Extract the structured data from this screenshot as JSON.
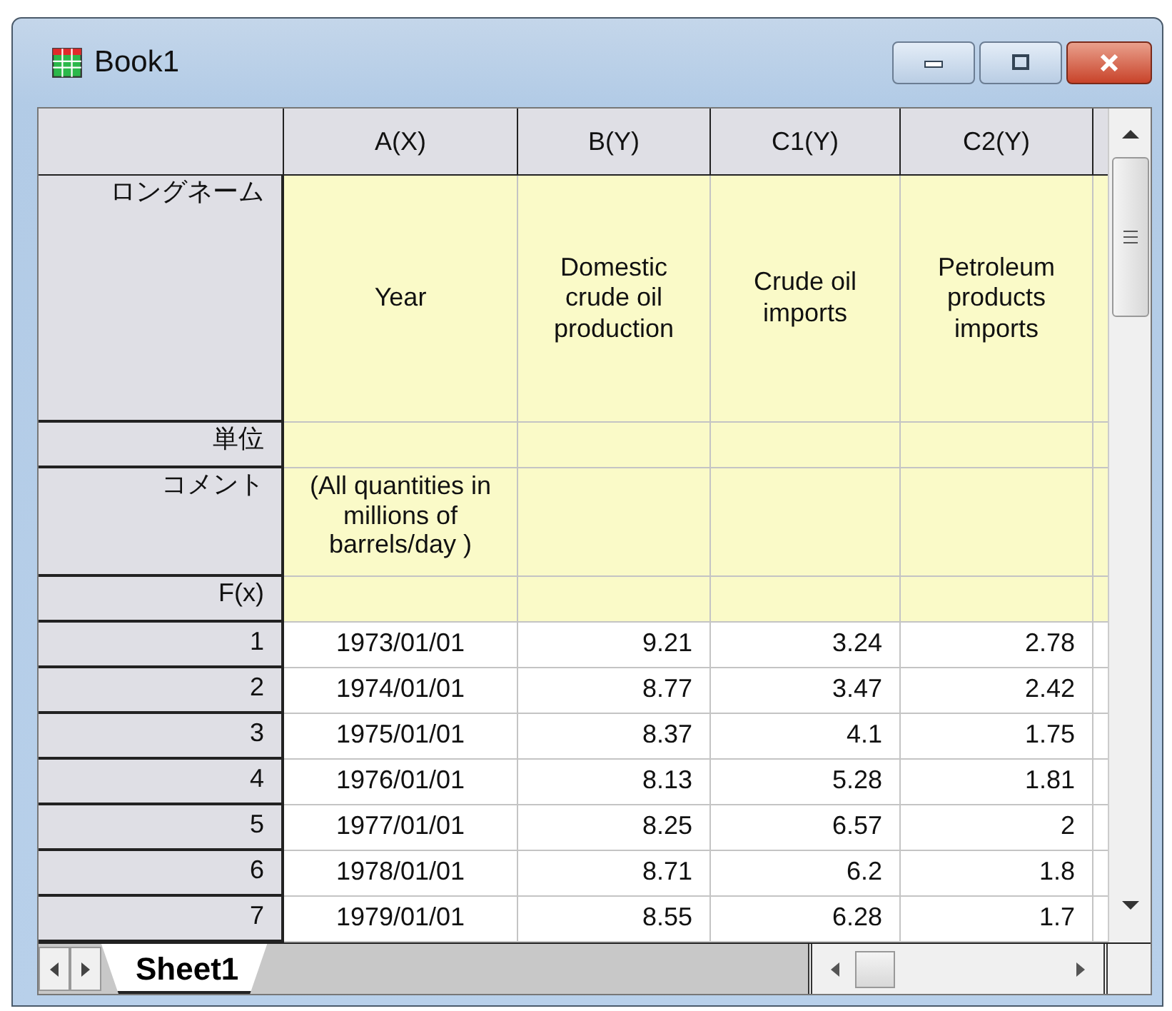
{
  "window": {
    "title": "Book1"
  },
  "columns": [
    {
      "name": "A(X)",
      "long_name": "Year",
      "comment": "(All quantities in millions of barrels/day )"
    },
    {
      "name": "B(Y)",
      "long_name": "Domestic crude oil production"
    },
    {
      "name": "C1(Y)",
      "long_name": "Crude oil imports"
    },
    {
      "name": "C2(Y)",
      "long_name": "Petroleum products imports"
    }
  ],
  "header_rows": [
    {
      "label": "ロングネーム",
      "kind": "long_name"
    },
    {
      "label": "単位",
      "kind": "unit"
    },
    {
      "label": "コメント",
      "kind": "comment"
    },
    {
      "label": "F(x)",
      "kind": "formula"
    }
  ],
  "rows": [
    {
      "label": "1",
      "cells": [
        "1973/01/01",
        "9.21",
        "3.24",
        "2.78"
      ]
    },
    {
      "label": "2",
      "cells": [
        "1974/01/01",
        "8.77",
        "3.47",
        "2.42"
      ]
    },
    {
      "label": "3",
      "cells": [
        "1975/01/01",
        "8.37",
        "4.1",
        "1.75"
      ]
    },
    {
      "label": "4",
      "cells": [
        "1976/01/01",
        "8.13",
        "5.28",
        "1.81"
      ]
    },
    {
      "label": "5",
      "cells": [
        "1977/01/01",
        "8.25",
        "6.57",
        "2"
      ]
    },
    {
      "label": "6",
      "cells": [
        "1978/01/01",
        "8.71",
        "6.2",
        "1.8"
      ]
    },
    {
      "label": "7",
      "cells": [
        "1979/01/01",
        "8.55",
        "6.28",
        "1.7"
      ]
    }
  ],
  "sheets": [
    {
      "label": "Sheet1",
      "selected": true
    }
  ]
}
